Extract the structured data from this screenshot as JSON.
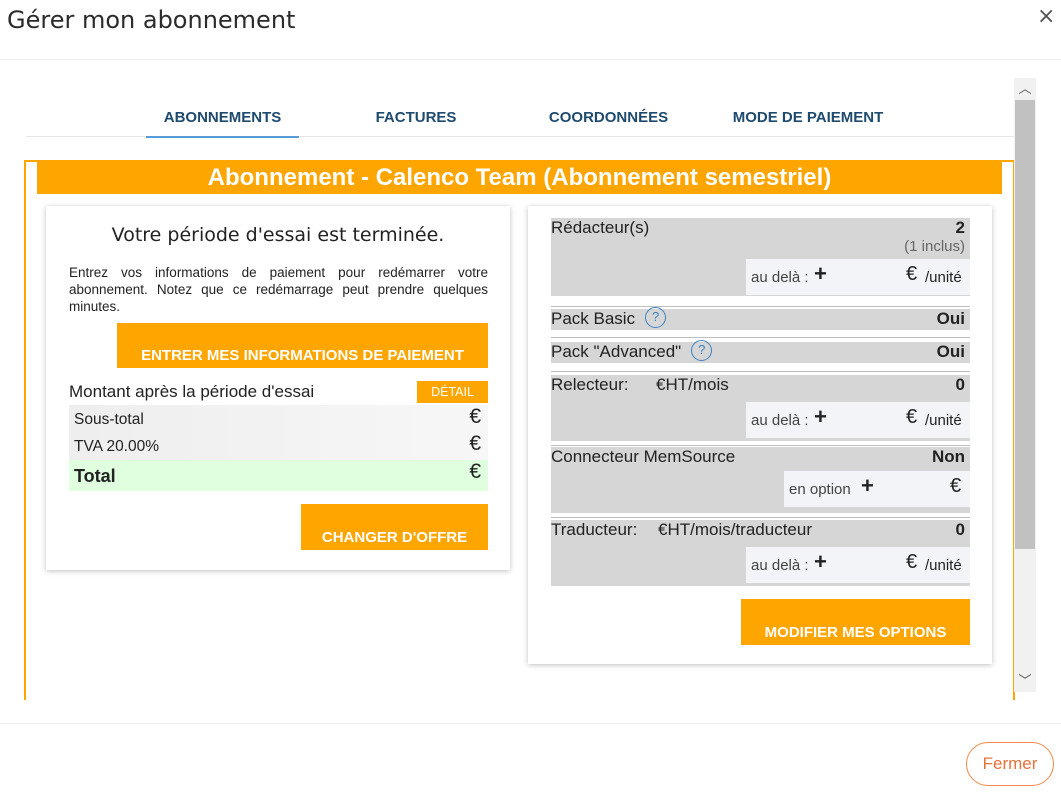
{
  "dialog": {
    "title": "Gérer mon abonnement",
    "close_glyph": "×"
  },
  "tabs": [
    {
      "label": "ABONNEMENTS",
      "active": true
    },
    {
      "label": "FACTURES",
      "active": false
    },
    {
      "label": "COORDONNÉES",
      "active": false
    },
    {
      "label": "MODE DE PAIEMENT",
      "active": false
    }
  ],
  "subscription": {
    "banner": "Abonnement - Calenco Team (Abonnement semestriel)"
  },
  "trial": {
    "heading": "Votre période d'essai est terminée.",
    "text": "Entrez vos informations de paiement pour redémarrer votre abonnement. Notez que ce redémarrage peut prendre quelques minutes.",
    "payment_button": "ENTRER MES INFORMATIONS DE PAIEMENT",
    "amount_label": "Montant après la période d'essai",
    "detail_button": "DÉTAIL",
    "rows": [
      {
        "label": "Sous-total",
        "value": "€"
      },
      {
        "label": "TVA 20.00%",
        "value": "€"
      },
      {
        "label": "Total",
        "value": "€"
      }
    ],
    "change_button": "CHANGER D'OFFRE"
  },
  "options": {
    "redacteurs": {
      "label": "Rédacteur(s)",
      "value": "2",
      "included": "(1 inclus)",
      "beyond": "au delà :",
      "plus": "+",
      "euro": "€",
      "unit": "/unité"
    },
    "pack_basic": {
      "label": "Pack Basic",
      "help": "?",
      "value": "Oui"
    },
    "pack_advanced": {
      "label": "Pack \"Advanced\"",
      "help": "?",
      "value": "Oui"
    },
    "relecteur": {
      "label": "Relecteur:",
      "price": "€HT/mois",
      "value": "0",
      "beyond": "au delà :",
      "plus": "+",
      "euro": "€",
      "unit": "/unité"
    },
    "memsource": {
      "label": "Connecteur MemSource",
      "value": "Non",
      "option": "en option",
      "plus": "+",
      "euro": "€"
    },
    "traducteur": {
      "label": "Traducteur:",
      "price": "€HT/mois/traducteur",
      "value": "0",
      "beyond": "au delà :",
      "plus": "+",
      "euro": "€",
      "unit": "/unité"
    },
    "modify_button": "MODIFIER MES OPTIONS"
  },
  "scrollbar": {
    "up_glyph": "︿",
    "down_glyph": "﹀"
  },
  "footer": {
    "close_button": "Fermer"
  },
  "colors": {
    "accent": "#ffa500",
    "tab_text": "#1e4a6e",
    "tab_underline": "#5b9bd5",
    "total_bg": "#dfffdf",
    "option_bg": "#d6d6d6",
    "close_button": "#e8733a"
  }
}
